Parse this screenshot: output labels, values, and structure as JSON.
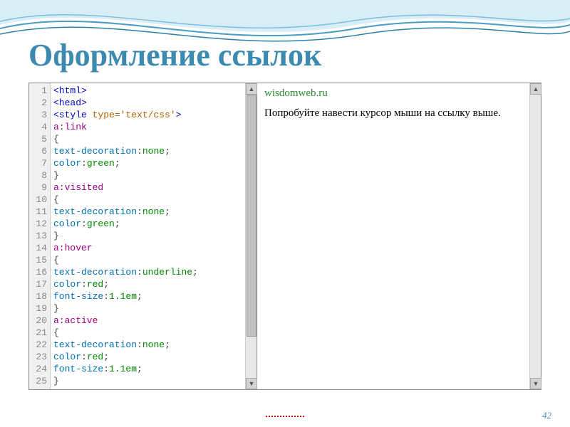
{
  "title": "Оформление ссылок",
  "page_number": "42",
  "code": {
    "line_numbers": [
      "1",
      "2",
      "3",
      "4",
      "5",
      "6",
      "7",
      "8",
      "9",
      "10",
      "11",
      "12",
      "13",
      "14",
      "15",
      "16",
      "17",
      "18",
      "19",
      "20",
      "21",
      "22",
      "23",
      "24",
      "25"
    ],
    "lines": [
      [
        {
          "c": "t-tag",
          "t": "<html>"
        }
      ],
      [
        {
          "c": "t-tag",
          "t": "<head>"
        }
      ],
      [
        {
          "c": "t-tag",
          "t": "<style "
        },
        {
          "c": "t-attr",
          "t": "type="
        },
        {
          "c": "t-str",
          "t": "'text/css'"
        },
        {
          "c": "t-tag",
          "t": ">"
        }
      ],
      [
        {
          "c": "t-sel",
          "t": "a:link"
        }
      ],
      [
        {
          "c": "t-punc",
          "t": "{"
        }
      ],
      [
        {
          "c": "t-prop",
          "t": "text-decoration"
        },
        {
          "c": "t-punc",
          "t": ":"
        },
        {
          "c": "t-val",
          "t": "none"
        },
        {
          "c": "t-punc",
          "t": ";"
        }
      ],
      [
        {
          "c": "t-prop",
          "t": "color"
        },
        {
          "c": "t-punc",
          "t": ":"
        },
        {
          "c": "t-val",
          "t": "green"
        },
        {
          "c": "t-punc",
          "t": ";"
        }
      ],
      [
        {
          "c": "t-punc",
          "t": "}"
        }
      ],
      [
        {
          "c": "t-sel",
          "t": "a:visited"
        }
      ],
      [
        {
          "c": "t-punc",
          "t": "{"
        }
      ],
      [
        {
          "c": "t-prop",
          "t": "text-decoration"
        },
        {
          "c": "t-punc",
          "t": ":"
        },
        {
          "c": "t-val",
          "t": "none"
        },
        {
          "c": "t-punc",
          "t": ";"
        }
      ],
      [
        {
          "c": "t-prop",
          "t": "color"
        },
        {
          "c": "t-punc",
          "t": ":"
        },
        {
          "c": "t-val",
          "t": "green"
        },
        {
          "c": "t-punc",
          "t": ";"
        }
      ],
      [
        {
          "c": "t-punc",
          "t": "}"
        }
      ],
      [
        {
          "c": "t-sel",
          "t": "a:hover"
        }
      ],
      [
        {
          "c": "t-punc",
          "t": "{"
        }
      ],
      [
        {
          "c": "t-prop",
          "t": "text-decoration"
        },
        {
          "c": "t-punc",
          "t": ":"
        },
        {
          "c": "t-val",
          "t": "underline"
        },
        {
          "c": "t-punc",
          "t": ";"
        }
      ],
      [
        {
          "c": "t-prop",
          "t": "color"
        },
        {
          "c": "t-punc",
          "t": ":"
        },
        {
          "c": "t-val",
          "t": "red"
        },
        {
          "c": "t-punc",
          "t": ";"
        }
      ],
      [
        {
          "c": "t-prop",
          "t": "font-size"
        },
        {
          "c": "t-punc",
          "t": ":"
        },
        {
          "c": "t-val",
          "t": "1.1em"
        },
        {
          "c": "t-punc",
          "t": ";"
        }
      ],
      [
        {
          "c": "t-punc",
          "t": "}"
        }
      ],
      [
        {
          "c": "t-sel",
          "t": "a:active"
        }
      ],
      [
        {
          "c": "t-punc",
          "t": "{"
        }
      ],
      [
        {
          "c": "t-prop",
          "t": "text-decoration"
        },
        {
          "c": "t-punc",
          "t": ":"
        },
        {
          "c": "t-val",
          "t": "none"
        },
        {
          "c": "t-punc",
          "t": ";"
        }
      ],
      [
        {
          "c": "t-prop",
          "t": "color"
        },
        {
          "c": "t-punc",
          "t": ":"
        },
        {
          "c": "t-val",
          "t": "red"
        },
        {
          "c": "t-punc",
          "t": ";"
        }
      ],
      [
        {
          "c": "t-prop",
          "t": "font-size"
        },
        {
          "c": "t-punc",
          "t": ":"
        },
        {
          "c": "t-val",
          "t": "1.1em"
        },
        {
          "c": "t-punc",
          "t": ";"
        }
      ],
      [
        {
          "c": "t-punc",
          "t": "}"
        }
      ]
    ]
  },
  "preview": {
    "link_text": "wisdomweb.ru",
    "body_text": "Попробуйте навести курсор мыши на ссылку выше."
  }
}
